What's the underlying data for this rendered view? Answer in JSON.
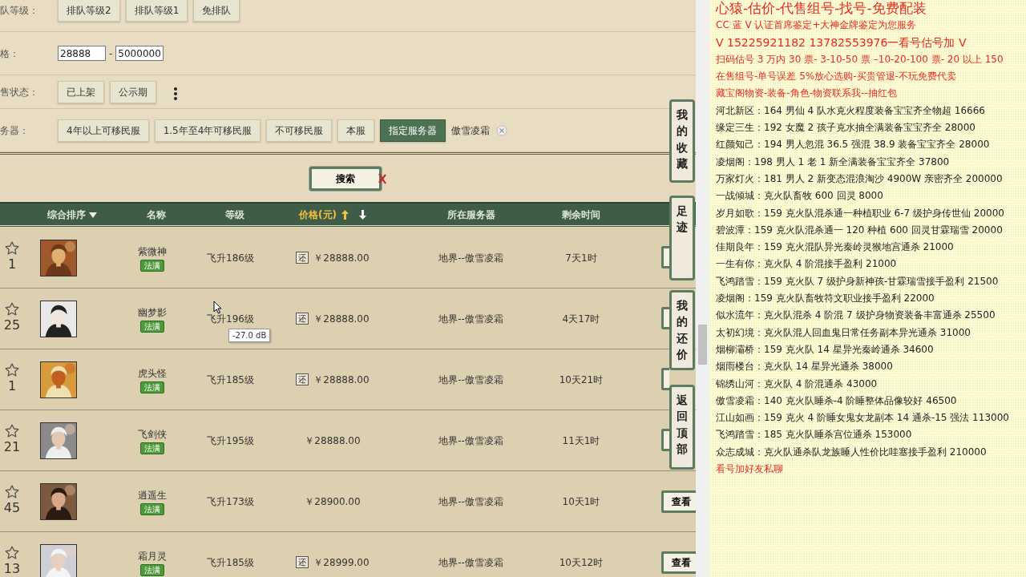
{
  "filters": [
    {
      "kind": "options",
      "label": "队等级：",
      "options": [
        {
          "label": "排队等级2",
          "selected": false
        },
        {
          "label": "排队等级1",
          "selected": false
        },
        {
          "label": "免排队",
          "selected": false
        }
      ]
    },
    {
      "kind": "range",
      "label": "格：",
      "min": "28888",
      "separator": "-",
      "max": "5000000"
    },
    {
      "kind": "options",
      "label": "售状态：",
      "options": [
        {
          "label": "已上架",
          "selected": false
        },
        {
          "label": "公示期",
          "selected": false
        }
      ],
      "more_menu": true
    },
    {
      "kind": "options",
      "label": "务器：",
      "options": [
        {
          "label": "4年以上可移民服",
          "selected": false
        },
        {
          "label": "1.5年至4年可移民服",
          "selected": false
        },
        {
          "label": "不可移民服",
          "selected": false
        },
        {
          "label": "本服",
          "selected": false
        },
        {
          "label": "指定服务器",
          "selected": true
        }
      ],
      "chip": "傲雪凌霜"
    }
  ],
  "search_button": "搜索",
  "table": {
    "columns": [
      {
        "kind": "dropdown",
        "label": "综合排序",
        "active": false
      },
      {
        "kind": "plain",
        "label": "名称",
        "active": false
      },
      {
        "kind": "plain",
        "label": "等级",
        "active": false
      },
      {
        "kind": "price_sort",
        "label": "价格(元)",
        "active": true
      },
      {
        "kind": "plain",
        "label": "所在服务器",
        "active": false
      },
      {
        "kind": "plain",
        "label": "剩余时间",
        "active": false
      }
    ],
    "rows": [
      {
        "favorites": "1",
        "name": "紫微神",
        "badge": "法满",
        "level": "飞升186级",
        "bargain_tag": "还",
        "price": "￥28888.00",
        "server": "地界--傲雪凌霜",
        "time_left": "7天1时"
      },
      {
        "favorites": "25",
        "name": "幽梦影",
        "badge": "法满",
        "level": "飞升196级",
        "bargain_tag": "还",
        "price": "￥28888.00",
        "server": "地界--傲雪凌霜",
        "time_left": "4天17时"
      },
      {
        "favorites": "1",
        "name": "虎头怪",
        "badge": "法满",
        "level": "飞升185级",
        "bargain_tag": "还",
        "price": "￥28888.00",
        "server": "地界--傲雪凌霜",
        "time_left": "10天21时"
      },
      {
        "favorites": "21",
        "name": "飞剑侠",
        "badge": "法满",
        "level": "飞升195级",
        "price": "￥28888.00",
        "server": "地界--傲雪凌霜",
        "time_left": "11天1时"
      },
      {
        "favorites": "45",
        "name": "逍遥生",
        "badge": "法满",
        "level": "飞升173级",
        "price": "￥28900.00",
        "server": "地界--傲雪凌霜",
        "time_left": "10天1时",
        "view_button": "查看"
      },
      {
        "favorites": "13",
        "name": "霜月灵",
        "badge": "法满",
        "level": "飞升185级",
        "bargain_tag": "还",
        "price": "￥28999.00",
        "server": "地界--傲雪凌霜",
        "time_left": "10天12时",
        "view_button": "查看"
      }
    ]
  },
  "side_tabs": [
    {
      "label": "我的收藏"
    },
    {
      "label": "足迹"
    },
    {
      "label": "我的还价"
    },
    {
      "label": "返回顶部"
    }
  ],
  "tooltip": "-27.0 dB",
  "notes": [
    {
      "kind": "title",
      "text": "心猿-估价-代售组号-找号-免费配装"
    },
    {
      "kind": "red",
      "text": "CC 蓝 V 认证首席鉴定+大神金牌鉴定为您服务"
    },
    {
      "kind": "red_large",
      "text": "V 15225921182      13782553976一看号估号加 V"
    },
    {
      "kind": "red",
      "text": "扫码估号 3 万内 30 票- 3-10-50 票  –10-20-100 票- 20 以上 150"
    },
    {
      "kind": "red",
      "text": "在售组号-单号误差 5%放心选购-买贵管退-不玩免费代卖"
    },
    {
      "kind": "red",
      "text": "藏宝阁物资-装备-角色-物资联系我--抽红包"
    },
    {
      "kind": "plain",
      "text": "河北新区：164 男仙 4 队水克火程度装备宝宝齐全物超 16666"
    },
    {
      "kind": "plain",
      "text": "缘定三生：192 女魔 2 孩子克水抽全满装备宝宝齐全 28000"
    },
    {
      "kind": "plain",
      "text": "红颜知己：194 男人忽混 36.5 强混 38.9 装备宝宝齐全 28000"
    },
    {
      "kind": "plain",
      "text": "凌烟阁：198 男人 1 老 1 新全满装备宝宝齐全 37800"
    },
    {
      "kind": "plain",
      "text": "万家灯火：181 男人 2 新变态混浪淘沙 4900W 亲密齐全 200000"
    },
    {
      "kind": "plain",
      "text": "一战倾城：克火队畜牧 600 回灵 8000"
    },
    {
      "kind": "plain",
      "text": "岁月如歌：159 克火队混杀通一种植职业 6-7 级护身传世仙 20000"
    },
    {
      "kind": "plain",
      "text": "碧波潭：159 克火队混杀通一 120 种植 600 回灵甘霖瑞雪 20000"
    },
    {
      "kind": "plain",
      "text": "佳期良年：159 克火混队异光秦岭灵猴地宫通杀 21000"
    },
    {
      "kind": "plain",
      "text": "一生有你：克火队 4 阶混接手盈利 21000"
    },
    {
      "kind": "plain",
      "text": "飞鸿踏雪：159 克火队 7 级护身新神孩-甘霖瑞雪接手盈利 21500"
    },
    {
      "kind": "plain",
      "text": "凌烟阁：159 克火队畜牧符文职业接手盈利 22000"
    },
    {
      "kind": "plain",
      "text": "似水流年：克火队混杀 4 阶混 7 级护身物资装备丰富通杀 25500"
    },
    {
      "kind": "plain",
      "text": "太初幻境：克火队混人回血鬼日常任务副本异光通杀 31000"
    },
    {
      "kind": "plain",
      "text": "烟柳灞桥：159 克火队 14 星异光秦岭通杀 34600"
    },
    {
      "kind": "plain",
      "text": "烟雨楼台：克火队 14 星异光通杀 38000"
    },
    {
      "kind": "plain",
      "text": "锦绣山河：克火队 4 阶混通杀 43000"
    },
    {
      "kind": "plain",
      "text": "傲雪凌霜：140 克火队睡杀-4 阶睡整体品像较好 46500"
    },
    {
      "kind": "plain",
      "text": "江山如画：159 克火 4 阶睡女鬼女龙副本 14 通杀-15 强法 113000"
    },
    {
      "kind": "plain",
      "text": "飞鸿踏雪：185 克火队睡杀宫位通杀 153000"
    },
    {
      "kind": "plain",
      "text": "众志成城：克火队通杀队龙族睡人性价比哇塞接手盈利 210000"
    },
    {
      "kind": "red",
      "text": "看号加好友私聊"
    }
  ]
}
